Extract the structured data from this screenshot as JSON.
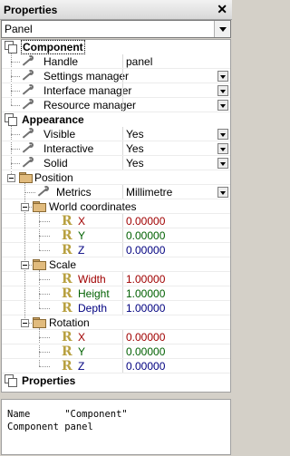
{
  "window": {
    "title": "Properties",
    "close": "✕"
  },
  "object_selector": {
    "value": "Panel"
  },
  "grid": {
    "component": {
      "label": "Component",
      "handle": {
        "label": "Handle",
        "value": "panel"
      },
      "settings_manager": {
        "label": "Settings manager",
        "value": ""
      },
      "interface_manager": {
        "label": "Interface manager",
        "value": ""
      },
      "resource_manager": {
        "label": "Resource manager",
        "value": ""
      }
    },
    "appearance": {
      "label": "Appearance",
      "visible": {
        "label": "Visible",
        "value": "Yes"
      },
      "interactive": {
        "label": "Interactive",
        "value": "Yes"
      },
      "solid": {
        "label": "Solid",
        "value": "Yes"
      },
      "position": {
        "label": "Position",
        "metrics": {
          "label": "Metrics",
          "value": "Millimetre"
        },
        "world_coordinates": {
          "label": "World coordinates",
          "x": {
            "label": "X",
            "value": "0.00000"
          },
          "y": {
            "label": "Y",
            "value": "0.00000"
          },
          "z": {
            "label": "Z",
            "value": "0.00000"
          }
        },
        "scale": {
          "label": "Scale",
          "width": {
            "label": "Width",
            "value": "1.00000"
          },
          "height": {
            "label": "Height",
            "value": "1.00000"
          },
          "depth": {
            "label": "Depth",
            "value": "1.00000"
          }
        },
        "rotation": {
          "label": "Rotation",
          "x": {
            "label": "X",
            "value": "0.00000"
          },
          "y": {
            "label": "Y",
            "value": "0.00000"
          },
          "z": {
            "label": "Z",
            "value": "0.00000"
          }
        }
      }
    },
    "properties": {
      "label": "Properties"
    }
  },
  "info_panel": {
    "line1": "Name      \"Component\"",
    "line2": "Component panel"
  },
  "colors": {
    "x_axis": "#a00000",
    "y_axis": "#006000",
    "z_axis": "#000080"
  },
  "icons": [
    "close-icon",
    "dropdown-arrow-icon",
    "category-icon",
    "wrench-icon",
    "folder-icon",
    "collapse-icon",
    "real-value-icon"
  ]
}
